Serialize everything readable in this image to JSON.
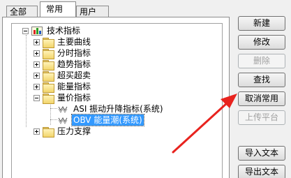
{
  "tabs": [
    {
      "label": "全部"
    },
    {
      "label": "常用",
      "active": true
    },
    {
      "label": "用户"
    }
  ],
  "tree": {
    "root": {
      "label": "技术指标",
      "icon": "bar-chart-icon"
    },
    "groups": [
      {
        "label": "主要曲线",
        "expanded": false
      },
      {
        "label": "分时指标",
        "expanded": false
      },
      {
        "label": "趋势指标",
        "expanded": false
      },
      {
        "label": "超买超卖",
        "expanded": false
      },
      {
        "label": "能量指标",
        "expanded": false
      },
      {
        "label": "量价指标",
        "expanded": true
      },
      {
        "label": "压力支撑",
        "expanded": false
      }
    ],
    "indicators": [
      {
        "label": "ASI 振动升降指标(系统)",
        "selected": false
      },
      {
        "label": "OBV 能量潮(系统)",
        "selected": true
      }
    ]
  },
  "buttons": {
    "new": {
      "label": "新建",
      "enabled": true
    },
    "modify": {
      "label": "修改",
      "enabled": true
    },
    "delete": {
      "label": "删除",
      "enabled": false
    },
    "find": {
      "label": "查找",
      "enabled": true
    },
    "remove_common": {
      "label": "取消常用",
      "enabled": true
    },
    "upload": {
      "label": "上传平台",
      "enabled": false
    },
    "import": {
      "label": "导入文本",
      "enabled": true
    },
    "export": {
      "label": "导出文本",
      "enabled": true
    }
  },
  "annotation": {
    "color": "#e8231e"
  }
}
